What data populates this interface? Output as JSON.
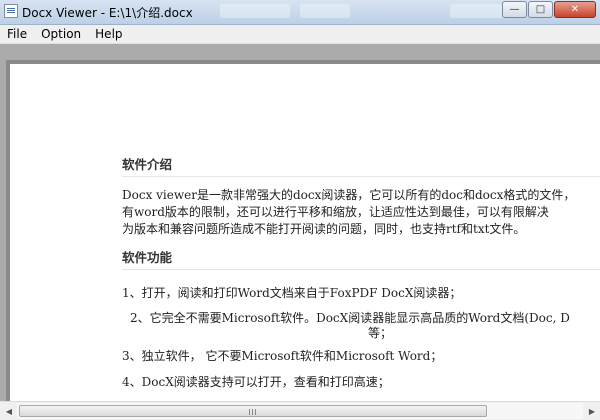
{
  "window": {
    "title": "Docx Viewer - E:\\1\\介绍.docx",
    "buttons": {
      "minimize": "—",
      "maximize": "□",
      "close": "✕"
    }
  },
  "menu": [
    "File",
    "Option",
    "Help"
  ],
  "document": {
    "heading_intro": "软件介绍",
    "intro_lines": [
      "Docx viewer是一款非常强大的docx阅读器，它可以所有的doc和docx格式的文件，",
      "有word版本的限制，还可以进行平移和缩放，让适应性达到最佳，可以有限解决",
      "为版本和兼容问题所造成不能打开阅读的问题，同时，也支持rtf和txt文件。"
    ],
    "heading_features": "软件功能",
    "features": [
      "1、打开，阅读和打印Word文档来自于FoxPDF DocX阅读器；",
      "2、它完全不需要Microsoft软件。DocX阅读器能显示高品质的Word文档(Doc, D",
      "等；",
      "3、独立软件，   它不要Microsoft软件和Microsoft Word；",
      "4、DocX阅读器支持可以打开，查看和打印高速；"
    ]
  }
}
